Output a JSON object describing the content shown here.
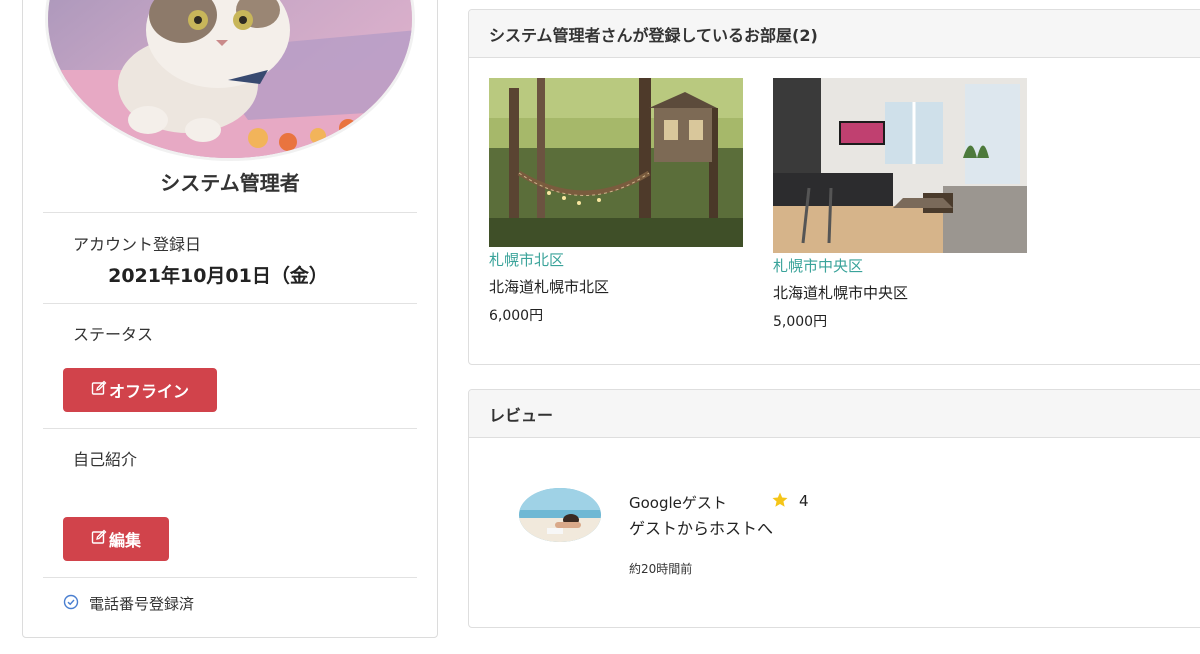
{
  "profile": {
    "name": "システム管理者",
    "account_label": "アカウント登録日",
    "account_date": "2021年10月01日（金）",
    "status_label": "ステータス",
    "status_button": "オフライン",
    "intro_label": "自己紹介",
    "edit_button": "編集",
    "phone_verified": "電話番号登録済"
  },
  "rooms_panel": {
    "title": "システム管理者さんが登録しているお部屋(2)",
    "rooms": [
      {
        "city": "札幌市北区",
        "address": "北海道札幌市北区",
        "price": "6,000円"
      },
      {
        "city": "札幌市中央区",
        "address": "北海道札幌市中央区",
        "price": "5,000円"
      }
    ]
  },
  "reviews_panel": {
    "title": "レビュー",
    "reviews": [
      {
        "name": "Googleゲスト",
        "rating": "4",
        "body": "ゲストからホストへ",
        "time": "約20時間前"
      }
    ]
  },
  "colors": {
    "accent_red": "#d1434b",
    "link_teal": "#3aa39a",
    "star": "#f5c518",
    "check_blue": "#4a7fd0"
  }
}
